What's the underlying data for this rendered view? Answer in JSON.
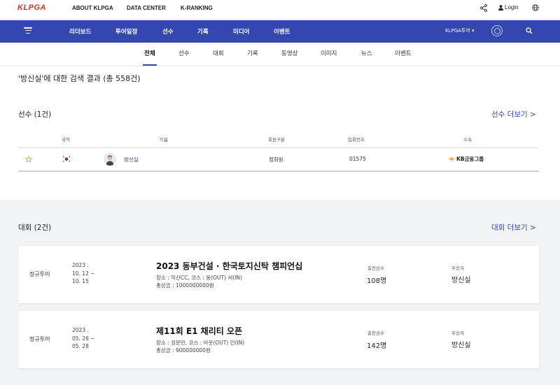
{
  "topbar": {
    "logo": "KLPGA",
    "links": [
      "ABOUT KLPGA",
      "DATA CENTER",
      "K-RANKING"
    ],
    "login": "Login",
    "icons": [
      "share-icon",
      "user-icon",
      "globe-icon"
    ]
  },
  "nav": {
    "items": [
      "리더보드",
      "투어일정",
      "선수",
      "기록",
      "미디어",
      "이벤트"
    ],
    "tour_select": "KLPGA투어 ▾",
    "color": "#3446b0"
  },
  "subtabs": {
    "items": [
      "전체",
      "선수",
      "대회",
      "기록",
      "동영상",
      "이미지",
      "뉴스",
      "이벤트"
    ],
    "active": "전체"
  },
  "result_title": "'방신실'에 대한 검색 결과 (총 558건)",
  "players": {
    "title": "선수 (1건)",
    "more": "선수 더보기 >",
    "headers": [
      "국적",
      "이름",
      "회원구분",
      "입회번호",
      "소속"
    ],
    "rows": [
      {
        "name": "방신실",
        "member_type": "정회원",
        "member_no": "01575",
        "sponsor": "KB금융그룹"
      }
    ]
  },
  "tournaments": {
    "title": "대회 (2건)",
    "more": "대회 더보기 >",
    "players_label": "출전선수",
    "winner_label": "우승자",
    "items": [
      {
        "tour_type": "정규투어",
        "date_year": "2023 .",
        "date_start": "10. 12 ~",
        "date_end": "10. 15",
        "name": "2023 동부건설 · 한국토지신탁 챔피언십",
        "venue": "장소 : 익산CC, 코스 : 동(OUT) 서(IN)",
        "prize": "총상금 : 1000000000원",
        "players": "108명",
        "winner": "방신실"
      },
      {
        "tour_type": "정규투어",
        "date_year": "2023 .",
        "date_start": "05. 26 ~",
        "date_end": "05. 28",
        "name": "제11회 E1 채리티 오픈",
        "venue": "장소 : 성문안, 코스 : 아웃(OUT) 인(IN)",
        "prize": "총상금 : 900000000원",
        "players": "142명",
        "winner": "방신실"
      }
    ]
  }
}
